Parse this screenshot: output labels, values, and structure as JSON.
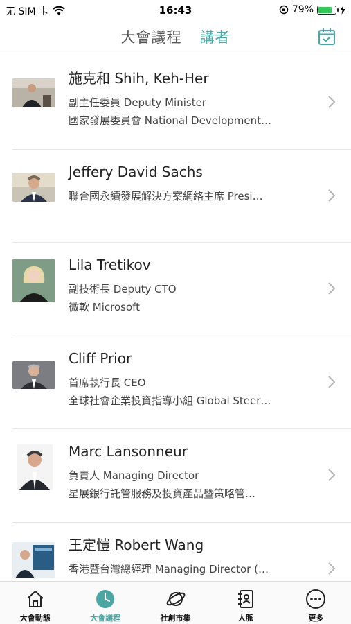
{
  "status_bar": {
    "carrier": "无 SIM 卡",
    "time": "16:43",
    "battery_percent": "79%",
    "battery_level": 0.79
  },
  "nav": {
    "tabs": [
      {
        "label": "大會議程",
        "active": false
      },
      {
        "label": "講者",
        "active": true
      }
    ],
    "accent_color": "#4aa7a3"
  },
  "speakers": [
    {
      "name": "施克和 Shih, Keh-Her",
      "line1": "副主任委員 Deputy Minister",
      "line2": "國家發展委員會 National Development…"
    },
    {
      "name": "Jeffery David Sachs",
      "line1": "聯合國永續發展解決方案網絡主席 Presi…",
      "line2": ""
    },
    {
      "name": "Lila Tretikov",
      "line1": "副技術長 Deputy CTO",
      "line2": "微軟 Microsoft"
    },
    {
      "name": "Cliff Prior",
      "line1": "首席執行長 CEO",
      "line2": "全球社會企業投資指導小組 Global Steer…"
    },
    {
      "name": "Marc Lansonneur",
      "line1": "負責人 Managing Director",
      "line2": "星展銀行託管服務及投資產品暨策略管…"
    },
    {
      "name": "王定愷 Robert Wang",
      "line1": "香港暨台灣總經理 Managing Director (…",
      "line2": ""
    }
  ],
  "tabbar": {
    "items": [
      {
        "label": "大會動態",
        "icon": "home-icon",
        "active": false
      },
      {
        "label": "大會議程",
        "icon": "clock-icon",
        "active": true
      },
      {
        "label": "社創市集",
        "icon": "planet-icon",
        "active": false
      },
      {
        "label": "人脈",
        "icon": "contacts-icon",
        "active": false
      },
      {
        "label": "更多",
        "icon": "more-icon",
        "active": false
      }
    ]
  }
}
